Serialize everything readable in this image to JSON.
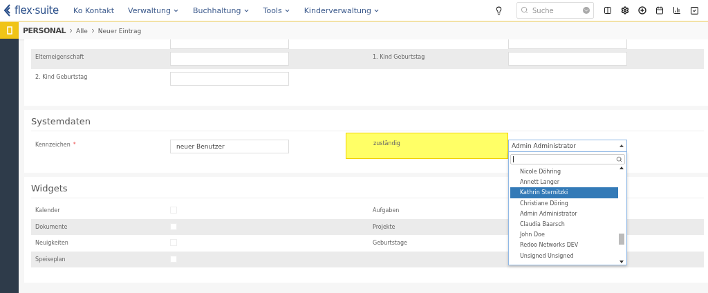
{
  "nav": {
    "logo": "flex·suite",
    "items": [
      {
        "label": "Ko Kontakt",
        "dropdown": false
      },
      {
        "label": "Verwaltung",
        "dropdown": true
      },
      {
        "label": "Buchhaltung",
        "dropdown": true
      },
      {
        "label": "Tools",
        "dropdown": true
      },
      {
        "label": "Kinderverwaltung",
        "dropdown": true
      }
    ],
    "search": {
      "placeholder": "Suche"
    }
  },
  "breadcrumb": {
    "module": "PERSONAL",
    "path": [
      "Alle",
      "Neuer Eintrag"
    ]
  },
  "personal_rows": [
    {
      "left_label": "Elterneigenschaft",
      "right_label": "1. Kind Geburtstag"
    },
    {
      "left_label": "2. Kind Geburtstag"
    }
  ],
  "systemdaten": {
    "title": "Systemdaten",
    "label": "Kennzeichen",
    "required_mark": "*",
    "value": "neuer Benutzer",
    "assignee_label": "zuständig",
    "assignee": "Admin Administrator",
    "dropdown": {
      "options": [
        {
          "label": "Nicole Döhring",
          "selected": false
        },
        {
          "label": "Annett Langer",
          "selected": false
        },
        {
          "label": "Kathrin Sternitzki",
          "selected": true
        },
        {
          "label": "Christiane Döring",
          "selected": false
        },
        {
          "label": "Admin Administrator",
          "selected": false
        },
        {
          "label": "Claudia Baarsch",
          "selected": false
        },
        {
          "label": "John Doe",
          "selected": false
        },
        {
          "label": "Redoo Networks DEV",
          "selected": false
        },
        {
          "label": "Unsigned Unsigned",
          "selected": false
        }
      ]
    }
  },
  "widgets": {
    "title": "Widgets",
    "rows": [
      {
        "left": {
          "label": "Kalender",
          "checked": false
        },
        "right": {
          "label": "Aufgaben"
        }
      },
      {
        "left": {
          "label": "Dokumente",
          "checked": false
        },
        "right": {
          "label": "Projekte"
        }
      },
      {
        "left": {
          "label": "Neuigkeiten",
          "checked": false
        },
        "right": {
          "label": "Geburtstage"
        }
      },
      {
        "left": {
          "label": "Speiseplan",
          "checked": false
        }
      }
    ]
  }
}
